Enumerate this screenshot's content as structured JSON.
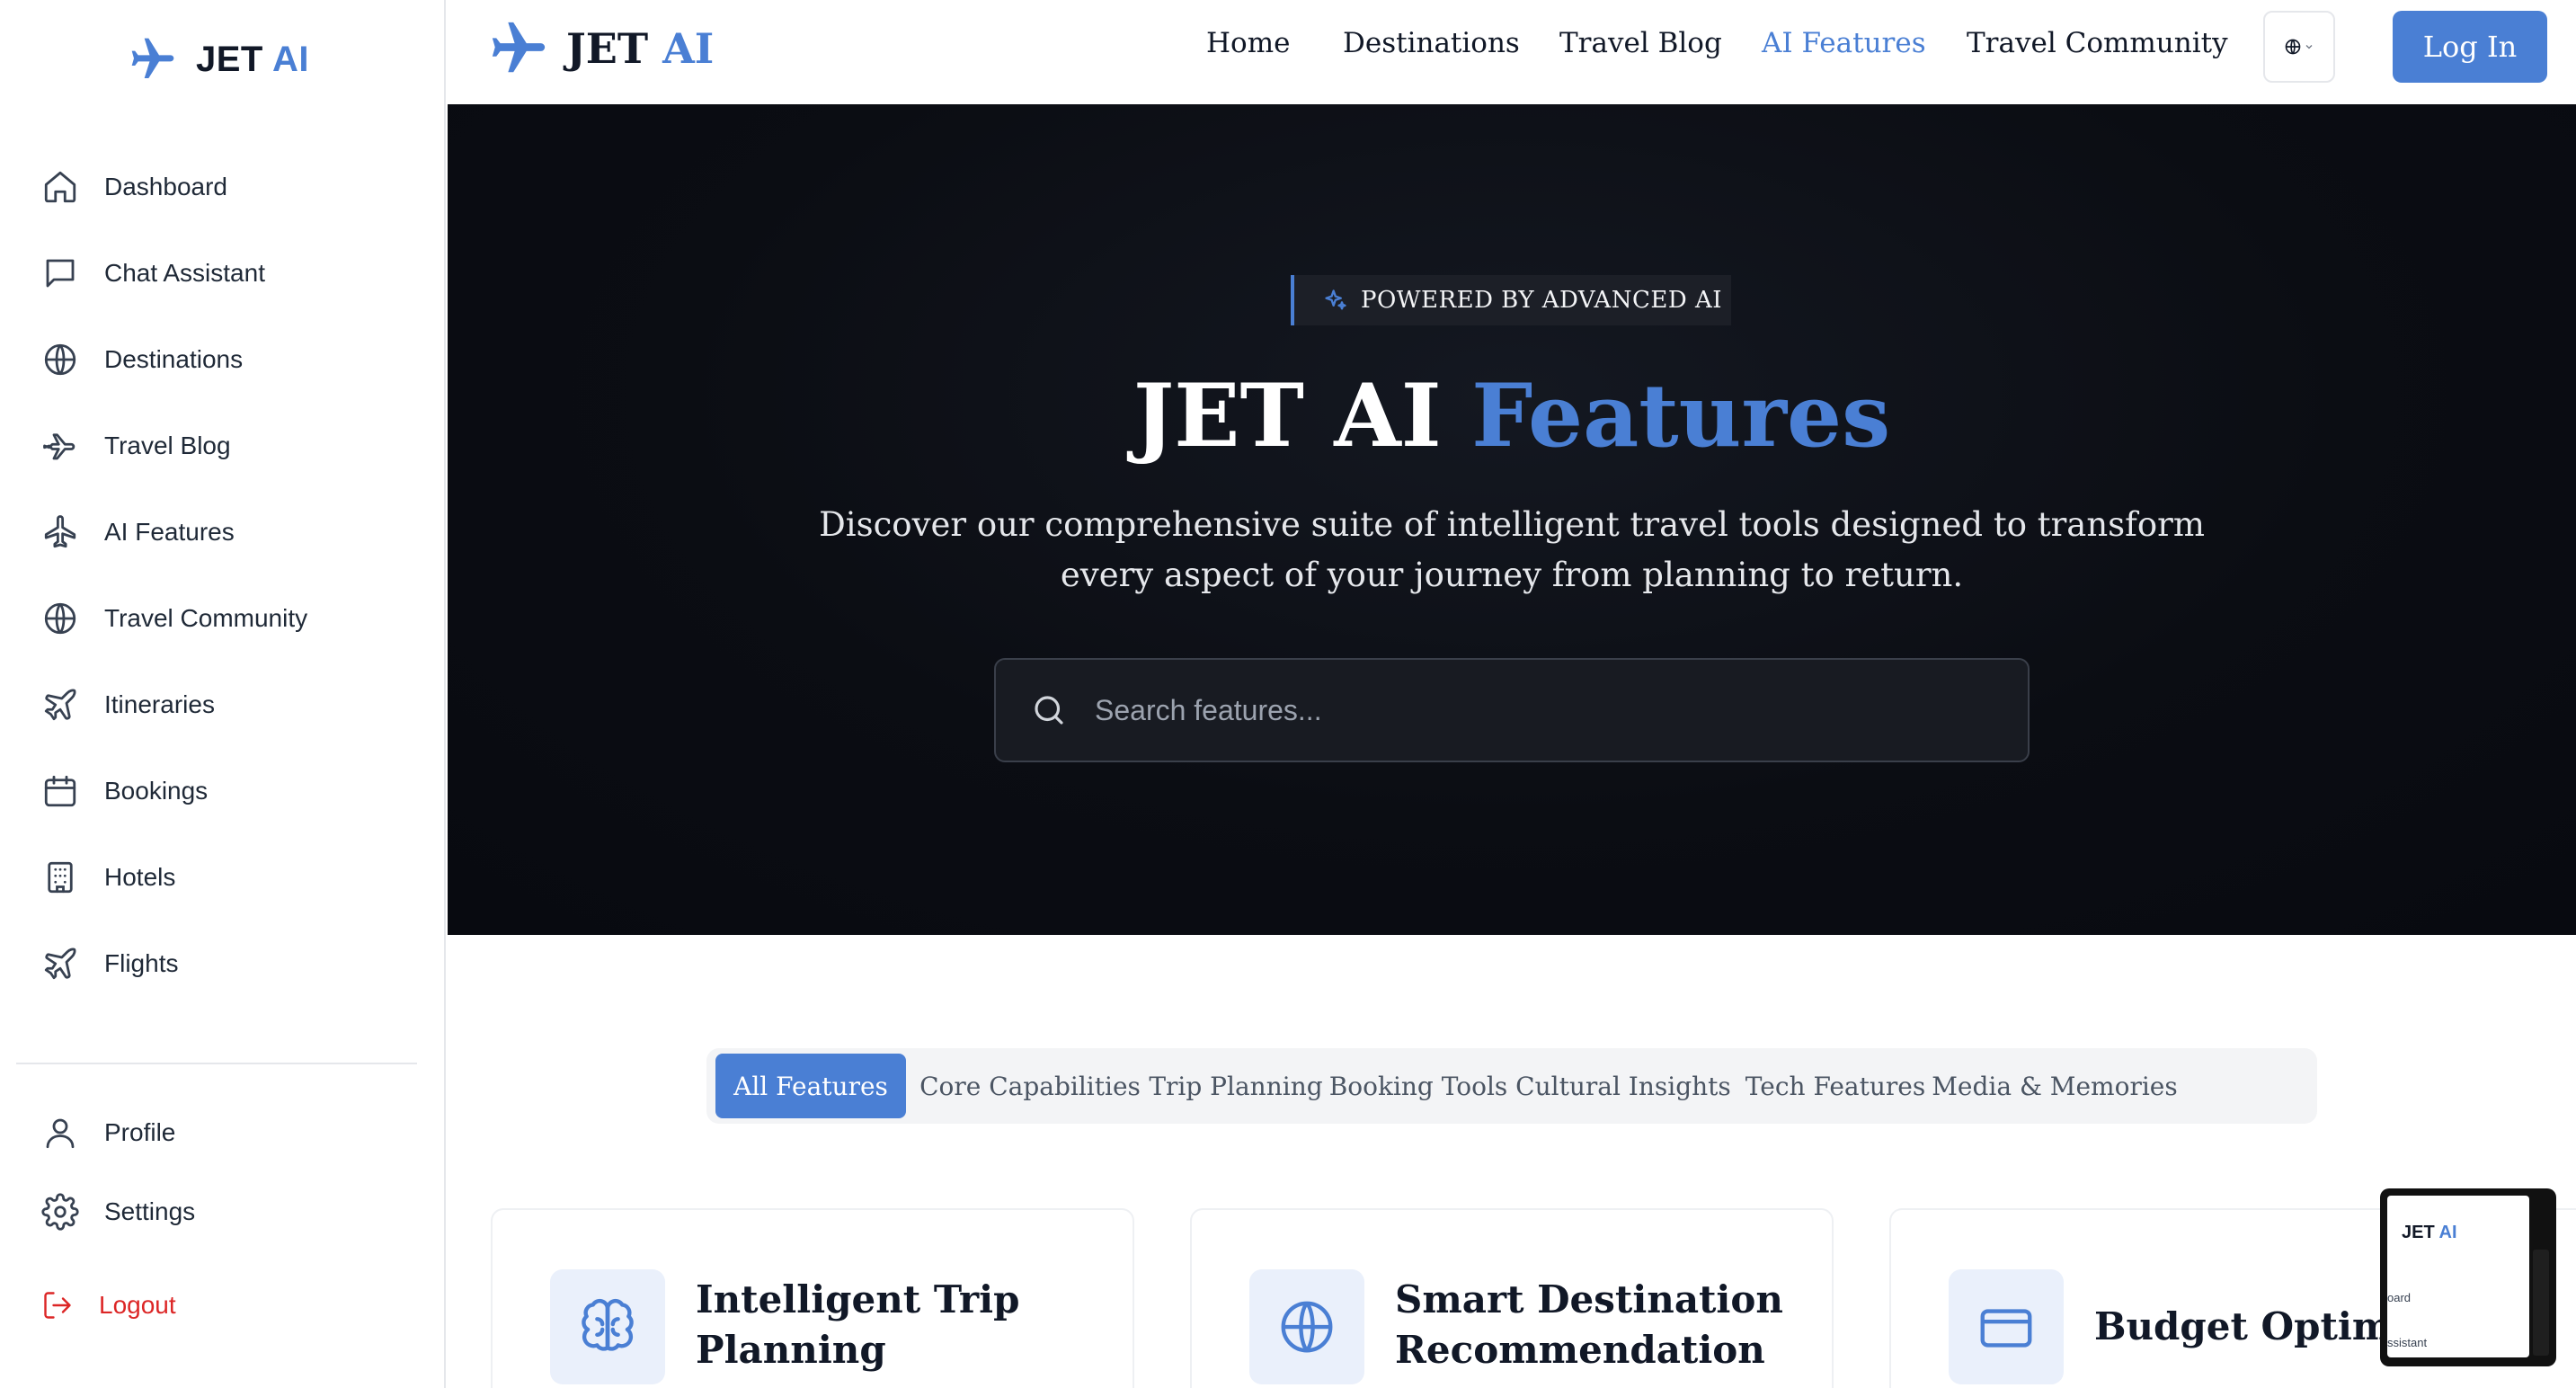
{
  "colors": {
    "accent": "#4a7fd4",
    "logout": "#dc2626",
    "hero_bg": "#0b0d13"
  },
  "sidebar": {
    "brand": {
      "main": "JET",
      "accent": "AI"
    },
    "items": [
      {
        "label": "Dashboard",
        "icon": "home-icon"
      },
      {
        "label": "Chat Assistant",
        "icon": "chat-icon"
      },
      {
        "label": "Destinations",
        "icon": "globe-icon"
      },
      {
        "label": "Travel Blog",
        "icon": "plane-icon"
      },
      {
        "label": "AI Features",
        "icon": "plane-up-icon"
      },
      {
        "label": "Travel Community",
        "icon": "globe-icon"
      },
      {
        "label": "Itineraries",
        "icon": "plane-tilt-icon"
      },
      {
        "label": "Bookings",
        "icon": "calendar-icon"
      },
      {
        "label": "Hotels",
        "icon": "building-icon"
      },
      {
        "label": "Flights",
        "icon": "plane-tilt-icon"
      }
    ],
    "bottom": [
      {
        "label": "Profile",
        "icon": "user-icon"
      },
      {
        "label": "Settings",
        "icon": "gear-icon"
      },
      {
        "label": "Logout",
        "icon": "logout-icon"
      }
    ]
  },
  "topbar": {
    "brand": {
      "main": "JET",
      "accent": "AI"
    },
    "links": [
      {
        "label": "Home"
      },
      {
        "label": "Destinations"
      },
      {
        "label": "Travel Blog"
      },
      {
        "label": "AI Features",
        "active": true
      },
      {
        "label": "Travel Community"
      }
    ],
    "language_icon": "globe-icon",
    "login_label": "Log In"
  },
  "hero": {
    "badge": "POWERED BY ADVANCED AI",
    "title_main": "JET AI",
    "title_accent": "Features",
    "subtitle_line1": "Discover our comprehensive suite of intelligent travel tools designed to transform",
    "subtitle_line2": "every aspect of your journey from planning to return.",
    "search_placeholder": "Search features..."
  },
  "tabs": [
    {
      "label": "All Features",
      "active": true
    },
    {
      "label": "Core Capabilities"
    },
    {
      "label": "Trip Planning"
    },
    {
      "label": "Booking Tools"
    },
    {
      "label": "Cultural Insights"
    },
    {
      "label": "Tech Features"
    },
    {
      "label": "Media & Memories"
    }
  ],
  "cards": [
    {
      "line1": "Intelligent Trip",
      "line2": "Planning",
      "icon": "brain-icon"
    },
    {
      "line1": "Smart Destination",
      "line2": "Recommendation",
      "icon": "globe-icon"
    },
    {
      "line1": "Budget Optimizat",
      "line2": "",
      "icon": "credit-card-icon"
    }
  ],
  "mini_preview": {
    "brand_main": "JET",
    "brand_accent": "AI",
    "line1": "oard",
    "line2": "ssistant"
  }
}
